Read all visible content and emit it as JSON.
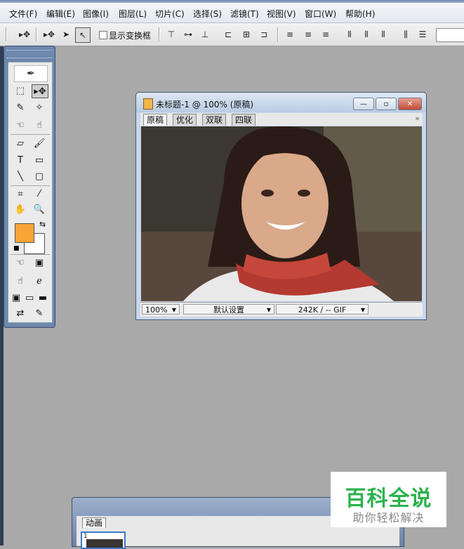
{
  "menubar": {
    "items": [
      "文件(F)",
      "编辑(E)",
      "图像(I)",
      "图层(L)",
      "切片(C)",
      "选择(S)",
      "滤镜(T)",
      "视图(V)",
      "窗口(W)",
      "帮助(H)"
    ]
  },
  "options_bar": {
    "checkbox_label": "显示变换框",
    "checkbox_checked": false
  },
  "toolbox": {
    "foreground_color": "#f9a437",
    "background_color": "#ffffff"
  },
  "document": {
    "title": "未标题-1 @ 100% (原稿)",
    "tabs": [
      "原稿",
      "优化",
      "双联",
      "四联"
    ],
    "active_tab": "原稿",
    "status": {
      "zoom": "100%",
      "preset": "默认设置",
      "info": "242K / -- GIF"
    }
  },
  "animation": {
    "tab_label": "动画",
    "frame_number": "1"
  },
  "watermark": {
    "main": "百科全说",
    "sub": "助你轻松解决"
  }
}
